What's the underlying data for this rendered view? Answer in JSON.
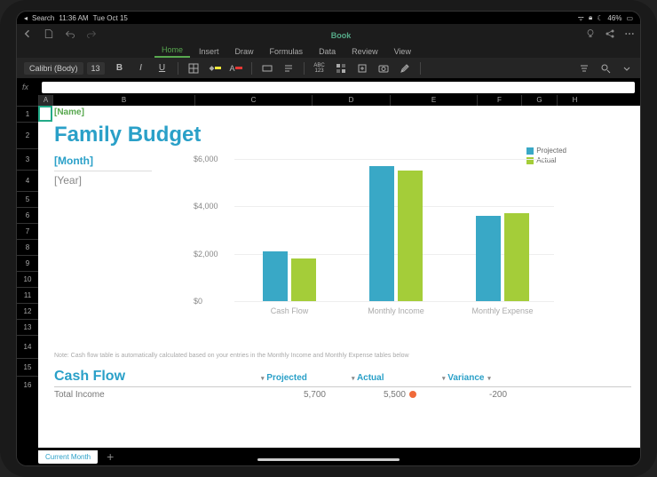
{
  "ios_status": {
    "back": "Search",
    "time": "11:36 AM",
    "date": "Tue Oct 15",
    "battery": "46%"
  },
  "nav": {
    "doc_title": "Book"
  },
  "ribbon": {
    "tabs": [
      "Home",
      "Insert",
      "Draw",
      "Formulas",
      "Data",
      "Review",
      "View"
    ],
    "active": 0
  },
  "toolbar": {
    "font_name": "Calibri (Body)",
    "font_size": "13",
    "labels": {
      "bold": "B",
      "italic": "I",
      "underline": "U",
      "abc": "ABC\n123"
    }
  },
  "formula": {
    "fx": "fx",
    "value": ""
  },
  "columns": [
    "A",
    "B",
    "C",
    "D",
    "E",
    "F",
    "G",
    "H"
  ],
  "row_numbers": [
    1,
    2,
    3,
    4,
    5,
    6,
    7,
    8,
    9,
    10,
    11,
    12,
    13,
    14,
    15,
    16
  ],
  "doc": {
    "name_placeholder": "[Name]",
    "title": "Family Budget",
    "month": "[Month]",
    "year": "[Year]"
  },
  "note": "Note: Cash flow table is automatically calculated based on your entries in the Monthly Income and Monthly Expense tables below",
  "cashflow": {
    "title": "Cash Flow",
    "headers": [
      "Projected",
      "Actual",
      "Variance"
    ],
    "row": {
      "label": "Total Income",
      "projected": "5,700",
      "actual": "5,500",
      "variance": "-200",
      "indicator": "negative"
    }
  },
  "sheet_tab": "Current Month",
  "chart_data": {
    "type": "bar",
    "title": "",
    "xlabel": "",
    "ylabel": "",
    "ylim": [
      0,
      6000
    ],
    "yticks": [
      0,
      2000,
      4000,
      6000
    ],
    "ytick_labels": [
      "$0",
      "$2,000",
      "$4,000",
      "$6,000"
    ],
    "categories": [
      "Cash Flow",
      "Monthly Income",
      "Monthly Expense"
    ],
    "series": [
      {
        "name": "Projected",
        "color": "#39a8c6",
        "values": [
          2100,
          5700,
          3600
        ]
      },
      {
        "name": "Actual",
        "color": "#a4cd39",
        "values": [
          1800,
          5500,
          3700
        ]
      }
    ]
  }
}
